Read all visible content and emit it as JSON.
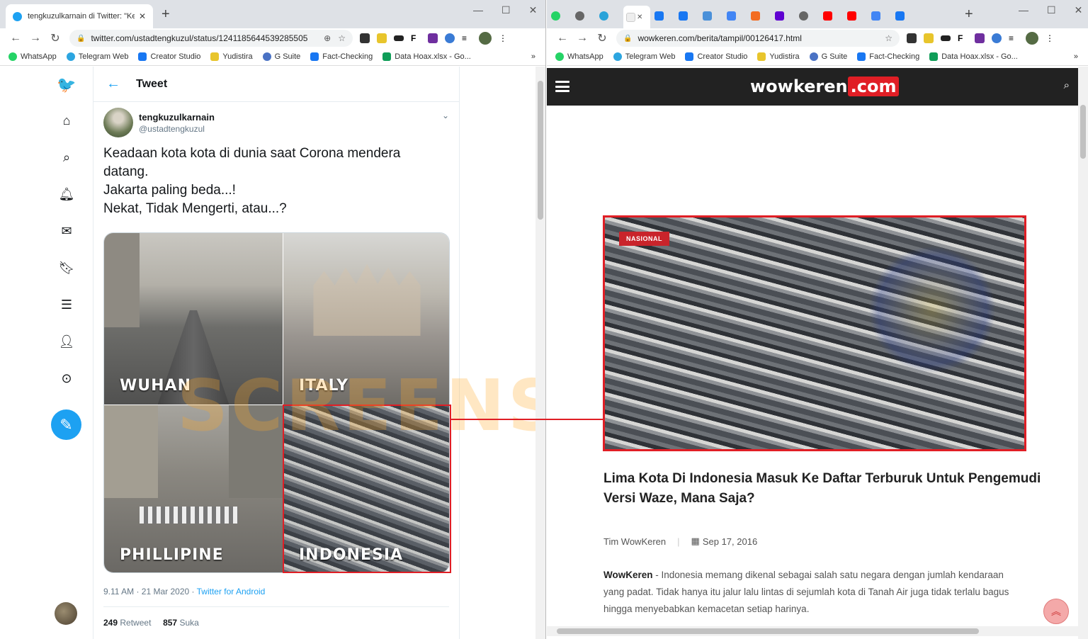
{
  "left_window": {
    "tab_title": "tengkuzulkarnain di Twitter: \"Kea",
    "url": "twitter.com/ustadtengkuzul/status/1241185644539285505",
    "bookmarks": [
      "WhatsApp",
      "Telegram Web",
      "Creator Studio",
      "Yudistira",
      "G Suite",
      "Fact-Checking",
      "Data Hoax.xlsx - Go..."
    ],
    "bookmarks_more": "»"
  },
  "right_window": {
    "url": "wowkeren.com/berita/tampil/00126417.html",
    "bookmarks": [
      "WhatsApp",
      "Telegram Web",
      "Creator Studio",
      "Yudistira",
      "G Suite",
      "Fact-Checking",
      "Data Hoax.xlsx - Go..."
    ],
    "bookmarks_more": "»"
  },
  "twitter": {
    "header_title": "Tweet",
    "author_name": "tengkuzulkarnain",
    "author_handle": "@ustadtengkuzul",
    "text_lines": [
      "Keadaan kota kota di dunia saat Corona mendera",
      "datang.",
      "Jakarta paling beda...!",
      "Nekat, Tidak Mengerti, atau...?"
    ],
    "image_labels": [
      "WUHAN",
      "ITALY",
      "PHILLIPINE",
      "INDONESIA"
    ],
    "timestamp": "9.11 AM · 21 Mar 2020 · ",
    "source": "Twitter for Android",
    "retweets": "249",
    "retweets_label": "Retweet",
    "likes": "857",
    "likes_label": "Suka"
  },
  "watermark": "SCREENSHOT",
  "wowkeren": {
    "logo_main": "wowkeren",
    "logo_suffix": ".com",
    "tag": "NASIONAL",
    "title": "Lima Kota Di Indonesia Masuk Ke Daftar Terburuk Untuk Pengemudi Versi Waze, Mana Saja?",
    "author": "Tim WowKeren",
    "date": "Sep 17, 2016",
    "body_lead": "WowKeren",
    "body_text": " - Indonesia memang dikenal sebagai salah satu negara dengan jumlah kendaraan yang padat. Tidak hanya itu jalur lalu lintas di sejumlah kota di Tanah Air juga tidak terlalu bagus hingga menyebabkan kemacetan setiap harinya."
  },
  "colors": {
    "twitter_blue": "#1da1f2",
    "highlight_red": "#e01e25",
    "wowkeren_header": "#222222"
  }
}
